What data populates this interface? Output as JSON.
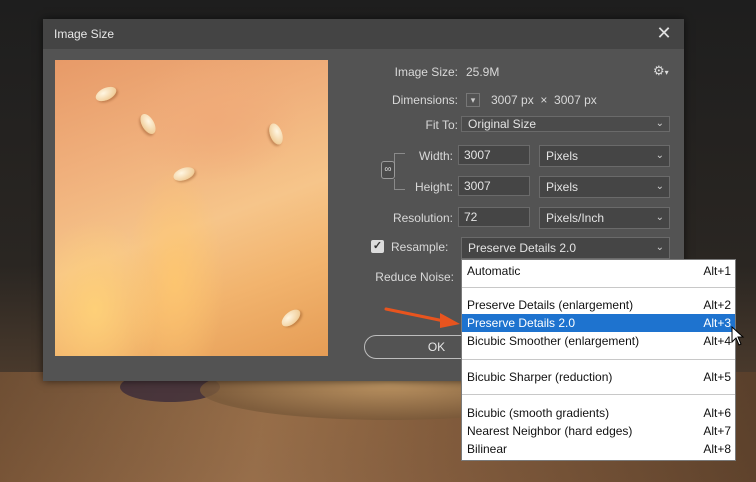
{
  "dialog": {
    "title": "Image Size",
    "close_glyph": "✕",
    "image_size_label": "Image Size:",
    "image_size_value": "25.9M",
    "settings_icon": "gear-icon",
    "dimensions_label": "Dimensions:",
    "dimensions_value": "3007 px  ×  3007 px",
    "fit_to_label": "Fit To:",
    "fit_to_value": "Original Size",
    "width_label": "Width:",
    "width_value": "3007",
    "width_unit": "Pixels",
    "height_label": "Height:",
    "height_value": "3007",
    "height_unit": "Pixels",
    "resolution_label": "Resolution:",
    "resolution_value": "72",
    "resolution_unit": "Pixels/Inch",
    "resample_checked": true,
    "resample_label": "Resample:",
    "resample_value": "Preserve Details 2.0",
    "reduce_noise_label": "Reduce Noise:",
    "ok_label": "OK"
  },
  "resample_menu": {
    "items": [
      {
        "label": "Automatic",
        "shortcut": "Alt+1"
      },
      {
        "label": "Preserve Details (enlargement)",
        "shortcut": "Alt+2"
      },
      {
        "label": "Preserve Details 2.0",
        "shortcut": "Alt+3",
        "selected": true
      },
      {
        "label": "Bicubic Smoother (enlargement)",
        "shortcut": "Alt+4"
      },
      {
        "label": "Bicubic Sharper (reduction)",
        "shortcut": "Alt+5"
      },
      {
        "label": "Bicubic (smooth gradients)",
        "shortcut": "Alt+6"
      },
      {
        "label": "Nearest Neighbor (hard edges)",
        "shortcut": "Alt+7"
      },
      {
        "label": "Bilinear",
        "shortcut": "Alt+8"
      }
    ]
  },
  "colors": {
    "dialog_bg": "#535353",
    "titlebar_bg": "#444444",
    "menu_highlight": "#1e73cf",
    "annotation_arrow": "#e8541e"
  }
}
